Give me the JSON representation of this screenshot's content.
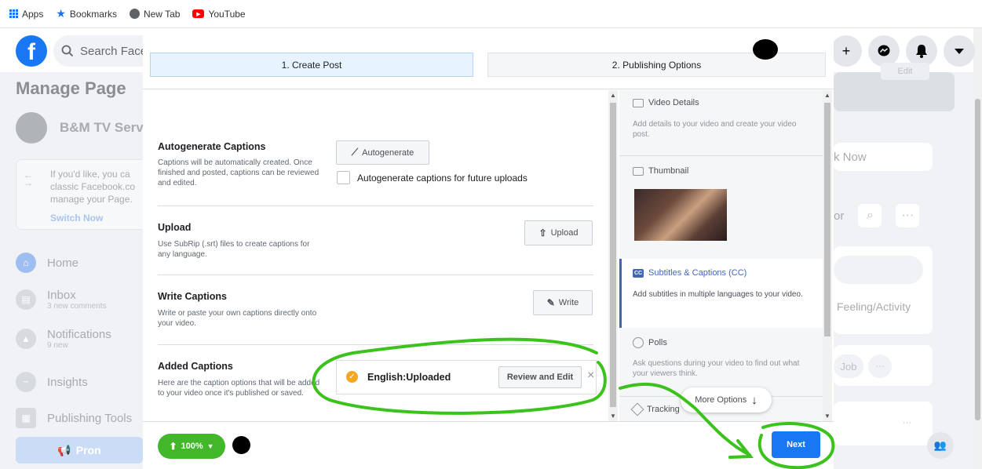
{
  "bookmarks": [
    {
      "label": "Apps",
      "icon": "apps-grid-icon",
      "color": "#1a73e8"
    },
    {
      "label": "Bookmarks",
      "icon": "star-icon",
      "color": "#1a73e8"
    },
    {
      "label": "New Tab",
      "icon": "globe-icon",
      "color": "#5f6368"
    },
    {
      "label": "YouTube",
      "icon": "youtube-icon",
      "color": "#ff0000"
    }
  ],
  "header": {
    "logo": "f",
    "search_placeholder": "Search Facebook",
    "icons": [
      "plus-icon",
      "messenger-icon",
      "bell-icon",
      "chevron-down-icon"
    ]
  },
  "sidebar": {
    "title": "Manage Page",
    "page_name": "B&M TV Servic",
    "classic_text": "If you'd like, you ca classic Facebook.co manage your Page.",
    "classic_link": "Switch Now",
    "items": [
      {
        "label": "Home",
        "sub": ""
      },
      {
        "label": "Inbox",
        "sub": "3 new comments"
      },
      {
        "label": "Notifications",
        "sub": "9 new"
      },
      {
        "label": "Insights",
        "sub": ""
      },
      {
        "label": "Publishing Tools",
        "sub": ""
      }
    ],
    "promote": "Pron"
  },
  "right_bg": {
    "book_now": "k Now",
    "edit": "Edit",
    "dots_text": "or",
    "feeling": "Feeling/Activity",
    "job": "Job"
  },
  "modal": {
    "tabs": [
      "1. Create Post",
      "2. Publishing Options"
    ],
    "sections": {
      "autogen": {
        "title": "Autogenerate Captions",
        "desc": "Captions will be automatically created. Once finished and posted, captions can be reviewed and edited.",
        "button": "Autogenerate",
        "checkbox": "Autogenerate captions for future uploads"
      },
      "upload": {
        "title": "Upload",
        "desc": "Use SubRip (.srt) files to create captions for any language.",
        "button": "Upload"
      },
      "write": {
        "title": "Write Captions",
        "desc": "Write or paste your own captions directly onto your video.",
        "button": "Write"
      },
      "added": {
        "title": "Added Captions",
        "desc": "Here are the caption options that will be added to your video once it's published or saved.",
        "caption_label": "English:Uploaded",
        "review_button": "Review and Edit",
        "close": "×"
      }
    },
    "right_panel": {
      "video_details": {
        "title": "Video Details",
        "desc": "Add details to your video and create your video post."
      },
      "thumbnail": {
        "title": "Thumbnail"
      },
      "subtitles": {
        "title": "Subtitles & Captions (CC)",
        "badge": "CC",
        "desc": "Add subtitles in multiple languages to your video."
      },
      "polls": {
        "title": "Polls",
        "desc": "Ask questions during your video to find out what your viewers think."
      },
      "tracking": {
        "title": "Tracking"
      },
      "more_options": "More Options"
    },
    "footer": {
      "progress": "100%",
      "next": "Next"
    }
  },
  "colors": {
    "fb_blue": "#1877f2",
    "green": "#42b72a",
    "annotation_green": "#3cc21c"
  }
}
